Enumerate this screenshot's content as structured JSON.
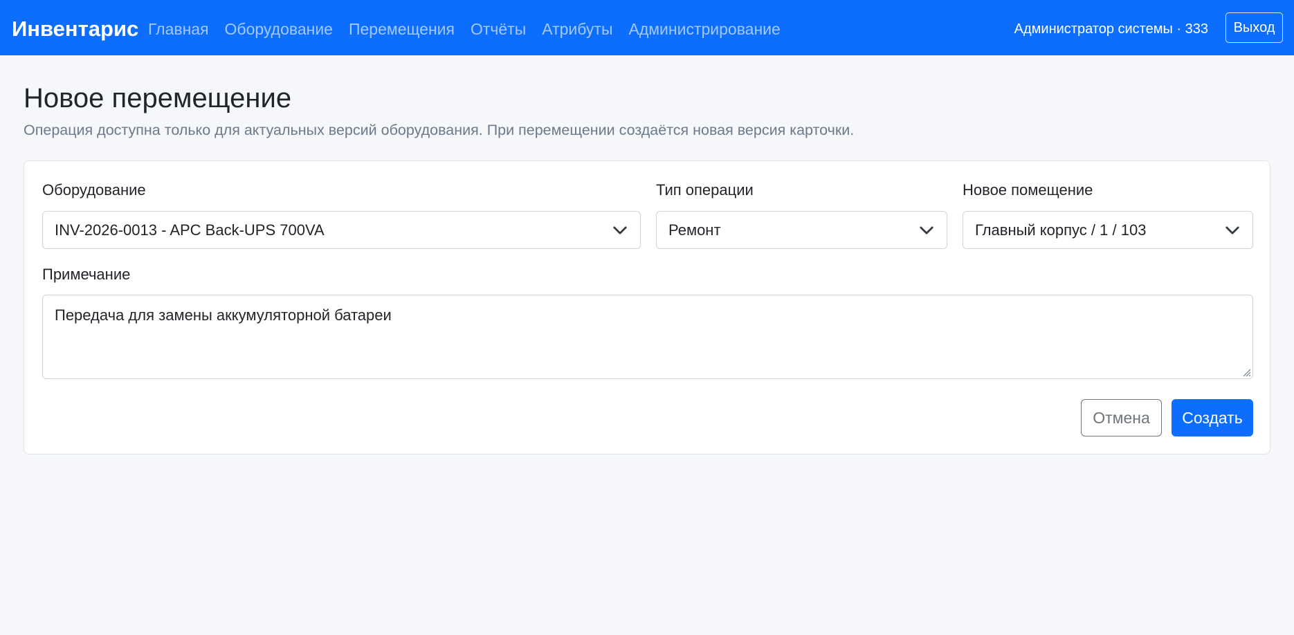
{
  "navbar": {
    "brand": "Инвентарис",
    "links": [
      {
        "label": "Главная"
      },
      {
        "label": "Оборудование"
      },
      {
        "label": "Перемещения"
      },
      {
        "label": "Отчёты"
      },
      {
        "label": "Атрибуты"
      },
      {
        "label": "Администрирование"
      }
    ],
    "user": "Администратор системы · 333",
    "logout_label": "Выход"
  },
  "page": {
    "title": "Новое перемещение",
    "subtitle": "Операция доступна только для актуальных версий оборудования. При перемещении создаётся новая версия карточки."
  },
  "form": {
    "equipment": {
      "label": "Оборудование",
      "value": "INV-2026-0013 - APC Back-UPS 700VA"
    },
    "operation_type": {
      "label": "Тип операции",
      "value": "Ремонт"
    },
    "new_room": {
      "label": "Новое помещение",
      "value": "Главный корпус / 1 / 103"
    },
    "note": {
      "label": "Примечание",
      "value": "Передача для замены аккумуляторной батареи"
    },
    "cancel_label": "Отмена",
    "submit_label": "Создать"
  },
  "colors": {
    "primary": "#0d6efd",
    "background": "#f5f7fa",
    "muted": "#6c757d"
  },
  "icons": {
    "select_arrow": "chevron-down-icon",
    "textarea_resize": "resize-grip-icon"
  }
}
